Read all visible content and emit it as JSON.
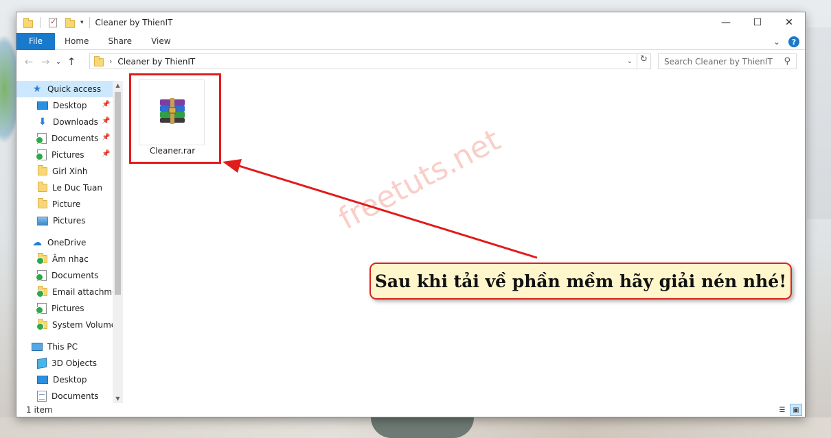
{
  "window": {
    "title": "Cleaner by ThienIT",
    "minimize": "—",
    "maximize": "☐",
    "close": "✕"
  },
  "ribbon": {
    "tabs": [
      "File",
      "Home",
      "Share",
      "View"
    ],
    "expand_icon": "⌄",
    "help_icon": "?"
  },
  "address": {
    "back": "←",
    "forward": "→",
    "recent": "⌄",
    "up": "↑",
    "path": "Cleaner by ThienIT",
    "separator": "›",
    "dropdown": "⌄",
    "refresh": "↻"
  },
  "search": {
    "placeholder": "Search Cleaner by ThienIT",
    "icon": "⚲"
  },
  "nav": {
    "quick_access": "Quick access",
    "items": [
      {
        "label": "Desktop",
        "icon": "desktop-icon"
      },
      {
        "label": "Downloads",
        "icon": "downloads-icon"
      },
      {
        "label": "Documents",
        "icon": "documents-icon"
      },
      {
        "label": "Pictures",
        "icon": "pictures-icon"
      },
      {
        "label": "Girl Xinh",
        "icon": "folder-icon"
      },
      {
        "label": "Le Duc Tuan",
        "icon": "folder-icon"
      },
      {
        "label": "Picture",
        "icon": "folder-icon"
      },
      {
        "label": "Pictures",
        "icon": "pictures-icon"
      }
    ],
    "onedrive": "OneDrive",
    "onedrive_items": [
      {
        "label": "Âm nhạc",
        "icon": "folder-icon"
      },
      {
        "label": "Documents",
        "icon": "documents-icon"
      },
      {
        "label": "Email attachmer",
        "icon": "folder-icon"
      },
      {
        "label": "Pictures",
        "icon": "pictures-icon"
      },
      {
        "label": "System Volume I",
        "icon": "folder-icon"
      }
    ],
    "thispc": "This PC",
    "thispc_items": [
      {
        "label": "3D Objects",
        "icon": "3d-objects-icon"
      },
      {
        "label": "Desktop",
        "icon": "desktop-icon"
      },
      {
        "label": "Documents",
        "icon": "documents-icon"
      }
    ],
    "pin": "📌"
  },
  "files": [
    {
      "name": "Cleaner.rar",
      "icon": "winrar-archive-icon"
    }
  ],
  "status": {
    "count": "1 item"
  },
  "annotation": {
    "watermark": "freetuts.net",
    "callout": "Sau khi tải về phần mềm hãy giải nén nhé!",
    "highlight_color": "#e21b1b",
    "callout_bg": "#fff6cc"
  },
  "colors": {
    "accent": "#1979ca",
    "selection": "#cce8ff"
  }
}
